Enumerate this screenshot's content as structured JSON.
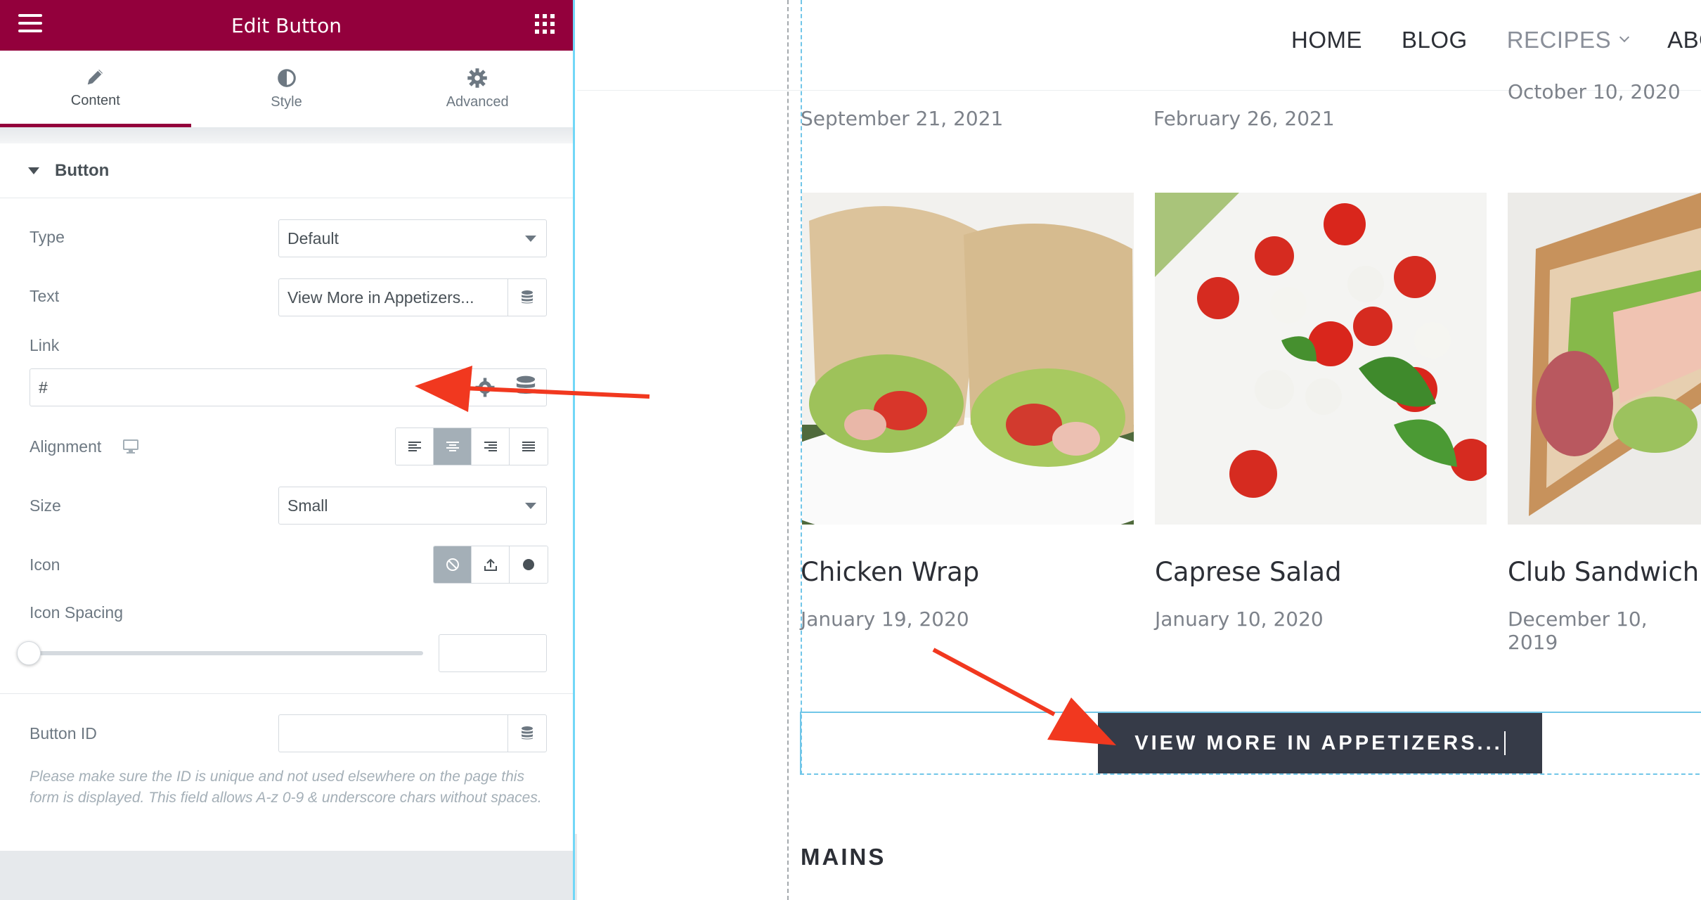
{
  "panel": {
    "title": "Edit Button",
    "tabs": [
      {
        "label": "Content",
        "icon": "pencil-icon",
        "active": true
      },
      {
        "label": "Style",
        "icon": "half-circle-icon",
        "active": false
      },
      {
        "label": "Advanced",
        "icon": "gear-icon",
        "active": false
      }
    ],
    "section": "Button",
    "fields": {
      "type_label": "Type",
      "type_value": "Default",
      "text_label": "Text",
      "text_value": "View More in Appetizers...",
      "link_label": "Link",
      "link_value": "#",
      "alignment_label": "Alignment",
      "alignment_selected": "center",
      "size_label": "Size",
      "size_value": "Small",
      "icon_label": "Icon",
      "icon_selected": "none",
      "icon_spacing_label": "Icon Spacing",
      "icon_spacing_value": "",
      "button_id_label": "Button ID",
      "button_id_value": ""
    },
    "help_text": "Please make sure the ID is unique and not used elsewhere on the page this form is displayed. This field allows A-z  0-9 & underscore chars without spaces."
  },
  "preview": {
    "nav": [
      "HOME",
      "BLOG",
      "RECIPES",
      "ABO"
    ],
    "top_dates": [
      "September 21, 2021",
      "February 26, 2021",
      "October 10, 2020"
    ],
    "cards": [
      {
        "title": "Chicken Wrap",
        "date": "January 19, 2020"
      },
      {
        "title": "Caprese Salad",
        "date": "January 10, 2020"
      },
      {
        "title": "Club Sandwich",
        "date": "December 10, 2019"
      }
    ],
    "cta_label": "VIEW MORE IN APPETIZERS...",
    "next_section": "MAINS"
  },
  "colors": {
    "header": "#93003c",
    "editor_border": "#71d7f7",
    "cta_bg": "#363b48",
    "arrow": "#f1381f"
  }
}
